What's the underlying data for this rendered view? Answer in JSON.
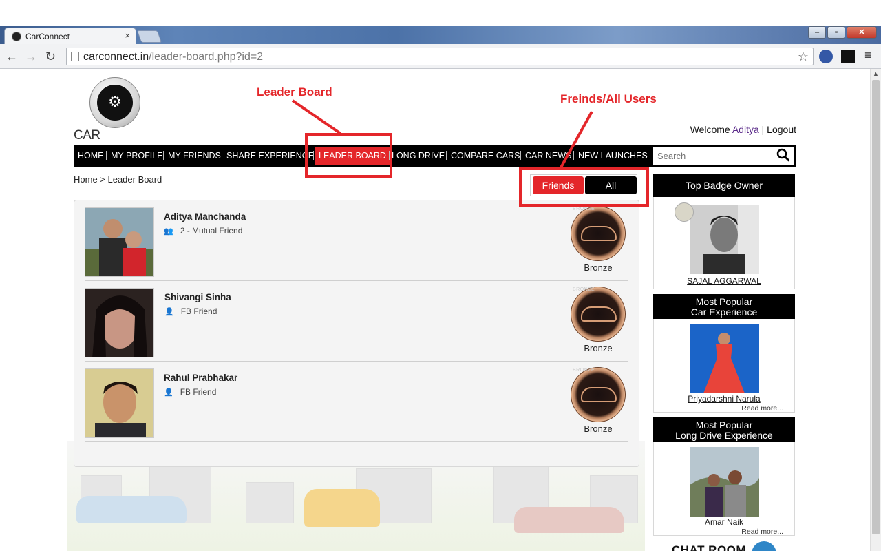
{
  "browser": {
    "tab_title": "CarConnect",
    "tab_close": "×",
    "url_domain": "carconnect.in",
    "url_path": "/leader-board.php?id=2",
    "window_minimize": "–",
    "window_maximize": "▫",
    "window_close": "✕"
  },
  "header": {
    "logo_text": "CAR CONNECT",
    "logo_glyph": "⚙",
    "welcome_prefix": "Welcome",
    "user_name": "Aditya",
    "separator": "|",
    "logout": "Logout"
  },
  "nav": {
    "items": [
      "HOME",
      "MY PROFILE",
      "MY FRIENDS",
      "SHARE EXPERIENCE",
      "LEADER BOARD",
      "LONG DRIVE",
      "COMPARE CARS",
      "CAR NEWS",
      "NEW LAUNCHES"
    ],
    "active": "LEADER BOARD",
    "search_placeholder": "Search"
  },
  "breadcrumb": "Home > Leader Board",
  "toggle": {
    "friends": "Friends",
    "all": "All",
    "selected": "Friends"
  },
  "annotations": {
    "leader_board": "Leader Board",
    "friends_all": "Freinds/All Users"
  },
  "leaders": [
    {
      "name": "Aditya Manchanda",
      "relation": "2 - Mutual Friend",
      "badge": "Bronze",
      "badge_tag": "BRONZE"
    },
    {
      "name": "Shivangi Sinha",
      "relation": "FB Friend",
      "badge": "Bronze",
      "badge_tag": "BRONZE"
    },
    {
      "name": "Rahul Prabhakar",
      "relation": "FB Friend",
      "badge": "Bronze",
      "badge_tag": "BRONZE"
    }
  ],
  "sidebar": {
    "top_badge": {
      "heading": "Top Badge Owner",
      "name": "SAJAL AGGARWAL"
    },
    "car_experience": {
      "heading_line1": "Most Popular",
      "heading_line2": "Car Experience",
      "name": "Priyadarshni Narula",
      "read_more": "Read more..."
    },
    "long_drive": {
      "heading_line1": "Most Popular",
      "heading_line2": "Long Drive Experience",
      "name": "Amar Naik",
      "read_more": "Read more..."
    },
    "chat_room": "CHAT ROOM"
  },
  "colors": {
    "accent": "#e4262a",
    "nav_bg": "#000000",
    "link": "#5b2b8a"
  }
}
